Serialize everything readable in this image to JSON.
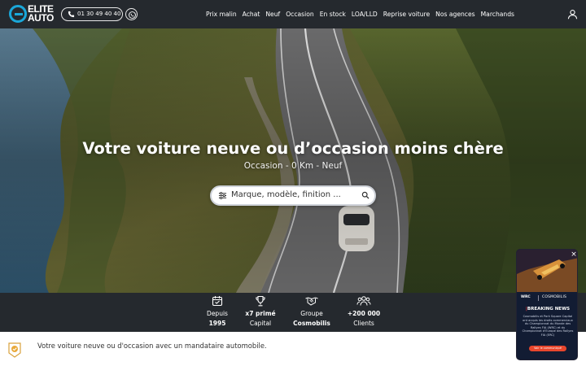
{
  "header": {
    "logo_line1": "ELITE",
    "logo_line2": "AUTO",
    "phone": "01 30 49 40 40",
    "nav": [
      "Prix malin",
      "Achat",
      "Neuf",
      "Occasion",
      "En stock",
      "LOA/LLD",
      "Reprise voiture",
      "Nos agences",
      "Marchands"
    ],
    "icons": {
      "phone": "phone-icon",
      "recall": "callback-icon",
      "account": "user-icon"
    }
  },
  "hero": {
    "title": "Votre voiture neuve ou d’occasion moins chère",
    "subtitle": "Occasion - 0 Km - Neuf",
    "search_placeholder": "Marque, modèle, finition ..."
  },
  "stats": [
    {
      "icon": "calendar-icon",
      "line1": "Depuis",
      "line2": "1995",
      "bold": "line2"
    },
    {
      "icon": "trophy-icon",
      "line1": "x7 primé",
      "line2": "Capital",
      "bold": "line1"
    },
    {
      "icon": "handshake-icon",
      "line1": "Groupe",
      "line2": "Cosmobilis",
      "bold": "line2"
    },
    {
      "icon": "users-icon",
      "line1": "+200 000",
      "line2": "Clients",
      "bold": "line1"
    }
  ],
  "strip": {
    "text": "Votre voiture neuve ou d'occasion avec un mandataire automobile."
  },
  "ad": {
    "close": "×",
    "logo_left": "WRC",
    "logo_right": "COSMOBILIS",
    "headline_bar": "|",
    "headline": "BREAKING NEWS",
    "body": "Cosmobilis et Park Square Capital ont acquis les droits commerciaux du Championnat du Monde des Rallyes FIA (WRC) et du Championnat d'Europe des Rallyes FIA (ERC)",
    "cta": "Voir le communiqué"
  },
  "colors": {
    "header_bg": "#25292e",
    "brand_blue": "#1aa7d9",
    "ad_bg": "#121c33",
    "ad_cta": "#e8462c"
  }
}
